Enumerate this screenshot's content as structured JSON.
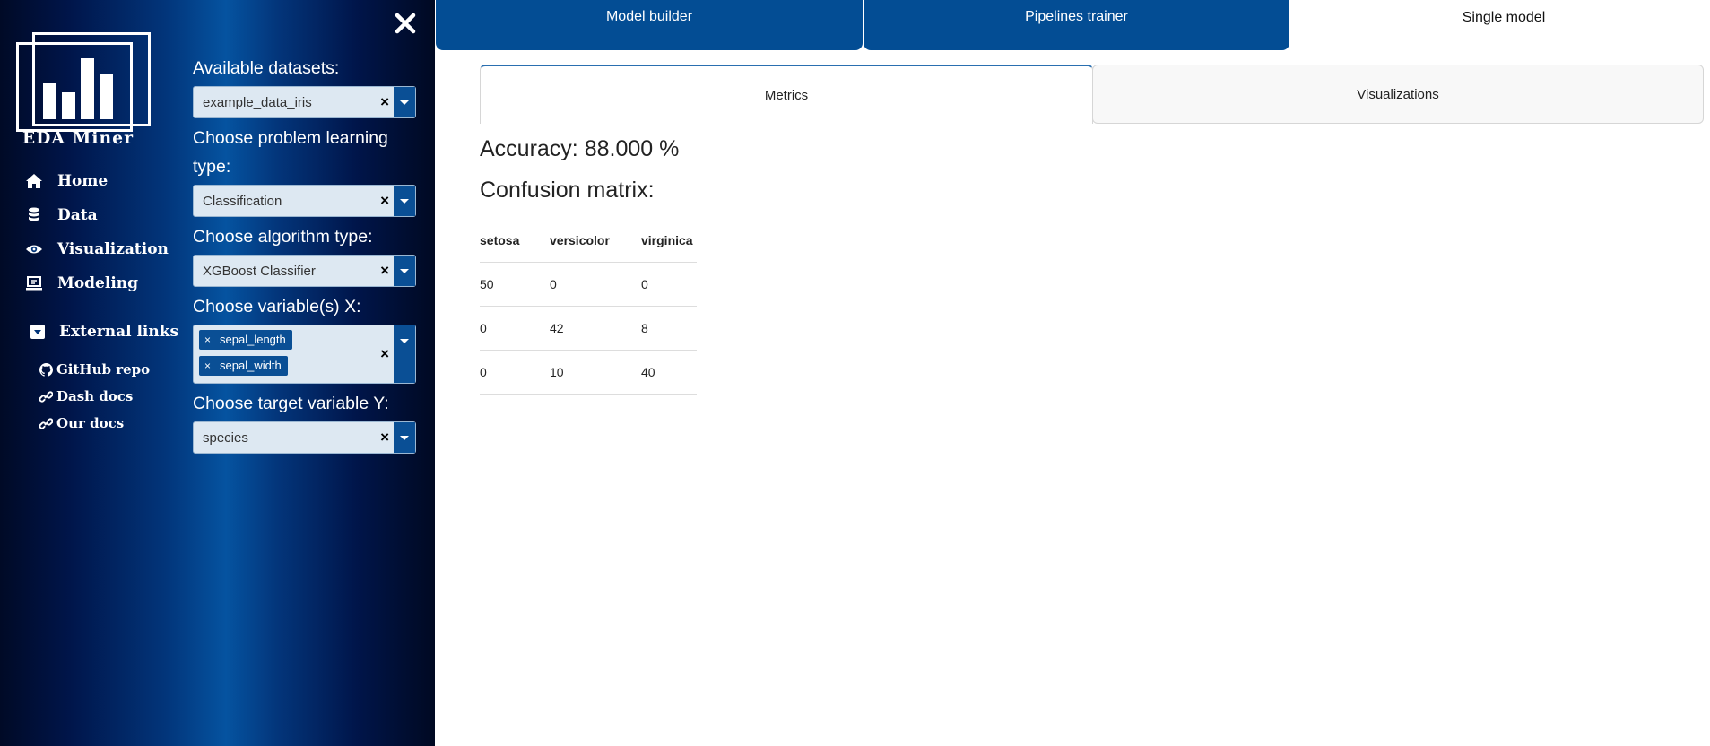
{
  "sidebar": {
    "logo_text": "EDA Miner",
    "nav": [
      {
        "label": "Home",
        "icon": "home-icon"
      },
      {
        "label": "Data",
        "icon": "database-icon"
      },
      {
        "label": "Visualization",
        "icon": "eye-icon"
      },
      {
        "label": "Modeling",
        "icon": "laptop-icon"
      }
    ],
    "external": {
      "label": "External links",
      "links": [
        {
          "label": "GitHub repo",
          "icon": "github-icon"
        },
        {
          "label": "Dash docs",
          "icon": "link-icon"
        },
        {
          "label": "Our docs",
          "icon": "link-icon"
        }
      ]
    }
  },
  "controls": {
    "datasets_label": "Available datasets:",
    "datasets_value": "example_data_iris",
    "problem_label": "Choose problem learning type:",
    "problem_value": "Classification",
    "algorithm_label": "Choose algorithm type:",
    "algorithm_value": "XGBoost Classifier",
    "x_label": "Choose variable(s) X:",
    "x_values": [
      "sepal_length",
      "sepal_width"
    ],
    "y_label": "Choose target variable Y:",
    "y_value": "species",
    "clear_glyph": "×",
    "tag_remove_glyph": "×"
  },
  "tabs": [
    "Model builder",
    "Pipelines trainer",
    "Single model"
  ],
  "subtabs": [
    "Metrics",
    "Visualizations"
  ],
  "metrics": {
    "accuracy": "Accuracy: 88.000 %",
    "confusion_title": "Confusion matrix:",
    "headers": [
      "setosa",
      "versicolor",
      "virginica"
    ],
    "rows": [
      [
        "50",
        "0",
        "0"
      ],
      [
        "0",
        "42",
        "8"
      ],
      [
        "0",
        "10",
        "40"
      ]
    ]
  },
  "colors": {
    "brand_blue": "#034d94",
    "accent": "#0a4f95"
  }
}
